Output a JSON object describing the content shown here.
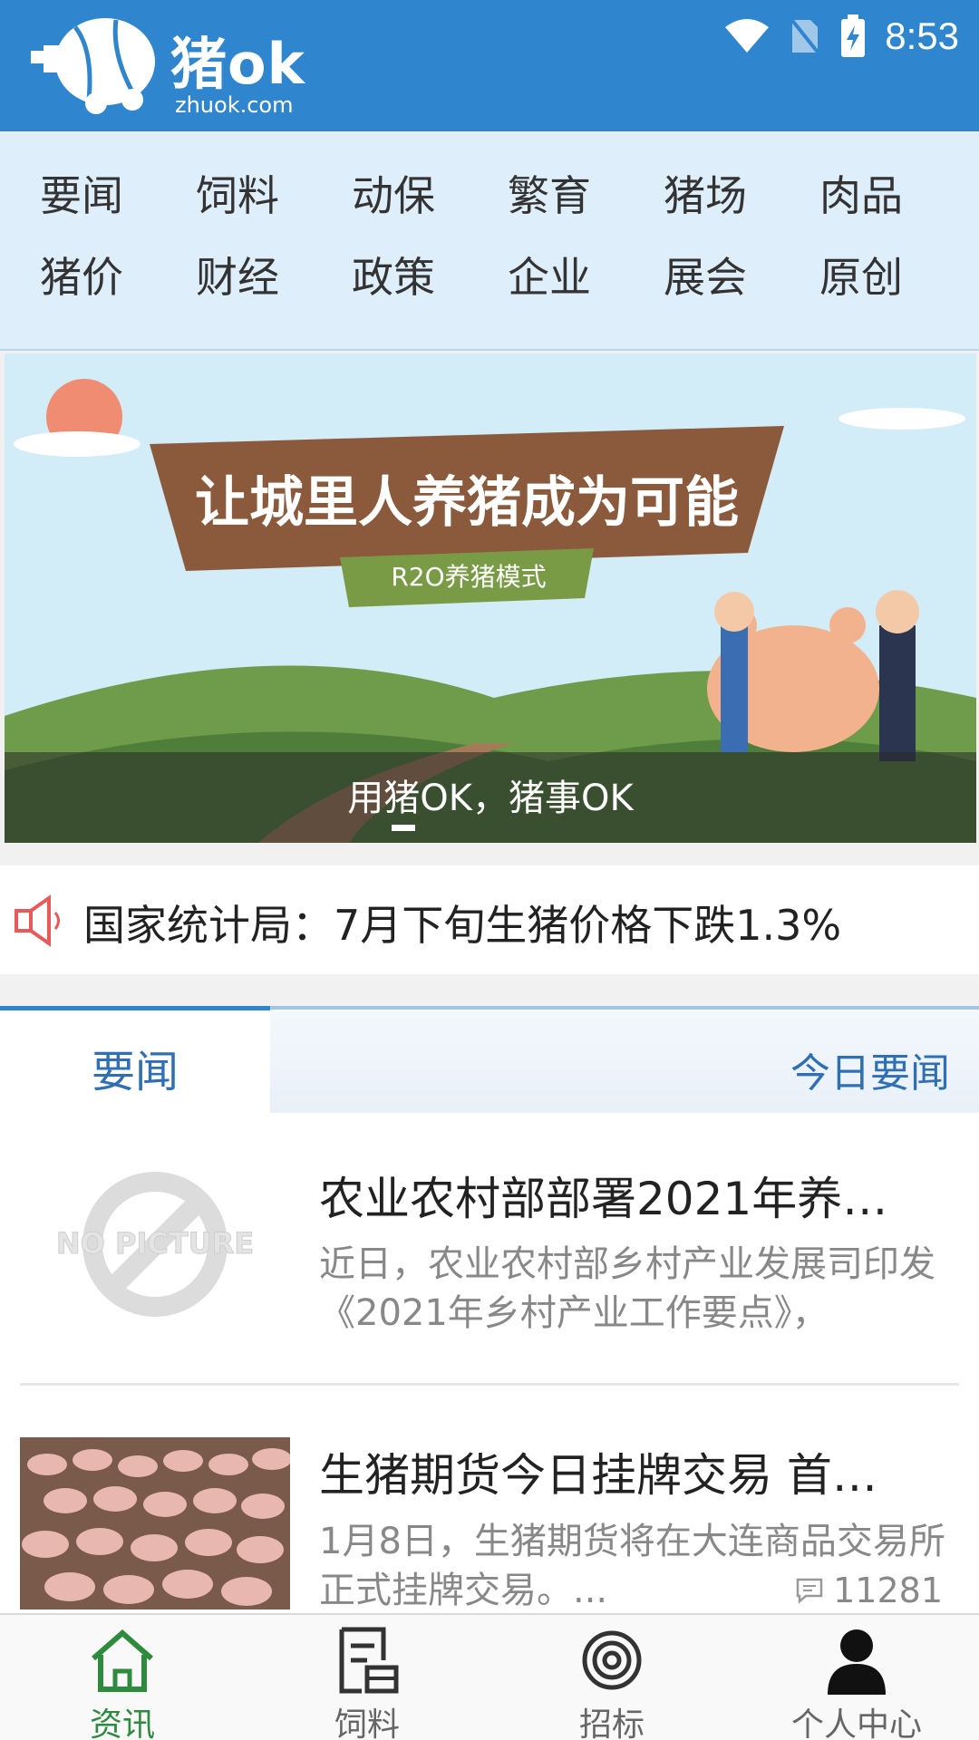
{
  "brand": {
    "name": "猪ok",
    "domain": "zhuok.com",
    "color": "#2f86cf"
  },
  "status_bar": {
    "time": "8:53",
    "icons": [
      "wifi-icon",
      "no-sim-icon",
      "battery-charging-icon"
    ]
  },
  "categories": [
    "要闻",
    "饲料",
    "动保",
    "繁育",
    "猪场",
    "肉品",
    "猪价",
    "财经",
    "政策",
    "企业",
    "展会",
    "原创"
  ],
  "banner": {
    "headline": "让城里人养猪成为可能",
    "subline": "R2O养猪模式",
    "caption": "用猪OK，猪事OK"
  },
  "notice": {
    "icon": "speaker-icon",
    "text": "国家统计局：7月下旬生猪价格下跌1.3%"
  },
  "section": {
    "active_tab": "要闻",
    "right_link": "今日要闻"
  },
  "news": [
    {
      "title": "农业农村部部署2021年养…",
      "desc": "近日，农业农村部乡村产业发展司印发《2021年乡村产业工作要点》，",
      "thumb_text": "NO PICTURE",
      "count": ""
    },
    {
      "title": "生猪期货今日挂牌交易 首…",
      "desc": "1月8日，生猪期货将在大连商品交易所正式挂牌交易。...",
      "thumb_text": "",
      "count": "11281"
    }
  ],
  "bottom_nav": [
    {
      "label": "资讯",
      "icon": "home-icon",
      "active": true
    },
    {
      "label": "饲料",
      "icon": "feed-document-icon",
      "active": false
    },
    {
      "label": "招标",
      "icon": "target-icon",
      "active": false
    },
    {
      "label": "个人中心",
      "icon": "person-icon",
      "active": false
    }
  ],
  "colors": {
    "active_nav": "#2e8b3e",
    "link_blue": "#2f6fb3",
    "notice_icon": "#e85a5a"
  }
}
